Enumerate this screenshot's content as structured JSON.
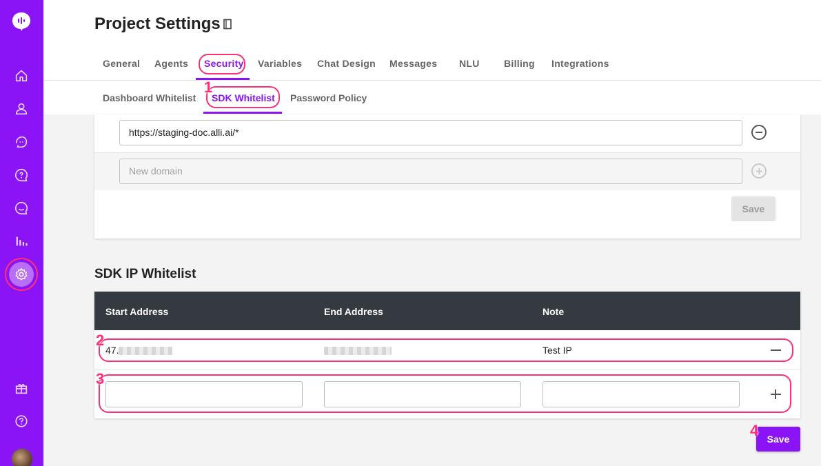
{
  "sidebar": {
    "items": [
      {
        "icon": "home-icon"
      },
      {
        "icon": "user-icon"
      },
      {
        "icon": "agent-chat-icon"
      },
      {
        "icon": "faq-icon"
      },
      {
        "icon": "conversation-icon"
      },
      {
        "icon": "analytics-icon"
      },
      {
        "icon": "settings-icon",
        "active": true
      },
      {
        "icon": "gift-icon"
      },
      {
        "icon": "help-icon"
      }
    ],
    "accent_color": "#8a14f5"
  },
  "header": {
    "title": "Project Settings",
    "tabs": [
      {
        "label": "General"
      },
      {
        "label": "Agents"
      },
      {
        "label": "Security",
        "active": true
      },
      {
        "label": "Variables"
      },
      {
        "label": "Chat Design"
      },
      {
        "label": "Messages"
      },
      {
        "label": "NLU"
      },
      {
        "label": "Billing"
      },
      {
        "label": "Integrations"
      }
    ],
    "subtabs": [
      {
        "label": "Dashboard Whitelist"
      },
      {
        "label": "SDK Whitelist",
        "active": true
      },
      {
        "label": "Password Policy"
      }
    ]
  },
  "domain_whitelist": {
    "domains": [
      "https://staging-doc.alli.ai/*"
    ],
    "new_placeholder": "New domain",
    "save_label": "Save"
  },
  "ip_whitelist": {
    "title": "SDK IP Whitelist",
    "columns": [
      "Start Address",
      "End Address",
      "Note"
    ],
    "rows": [
      {
        "start": "47.",
        "end": "",
        "note": "Test IP"
      }
    ],
    "save_label": "Save"
  },
  "annotations": [
    "1",
    "2",
    "3",
    "4"
  ],
  "annotation_color": "#ff2e7a"
}
